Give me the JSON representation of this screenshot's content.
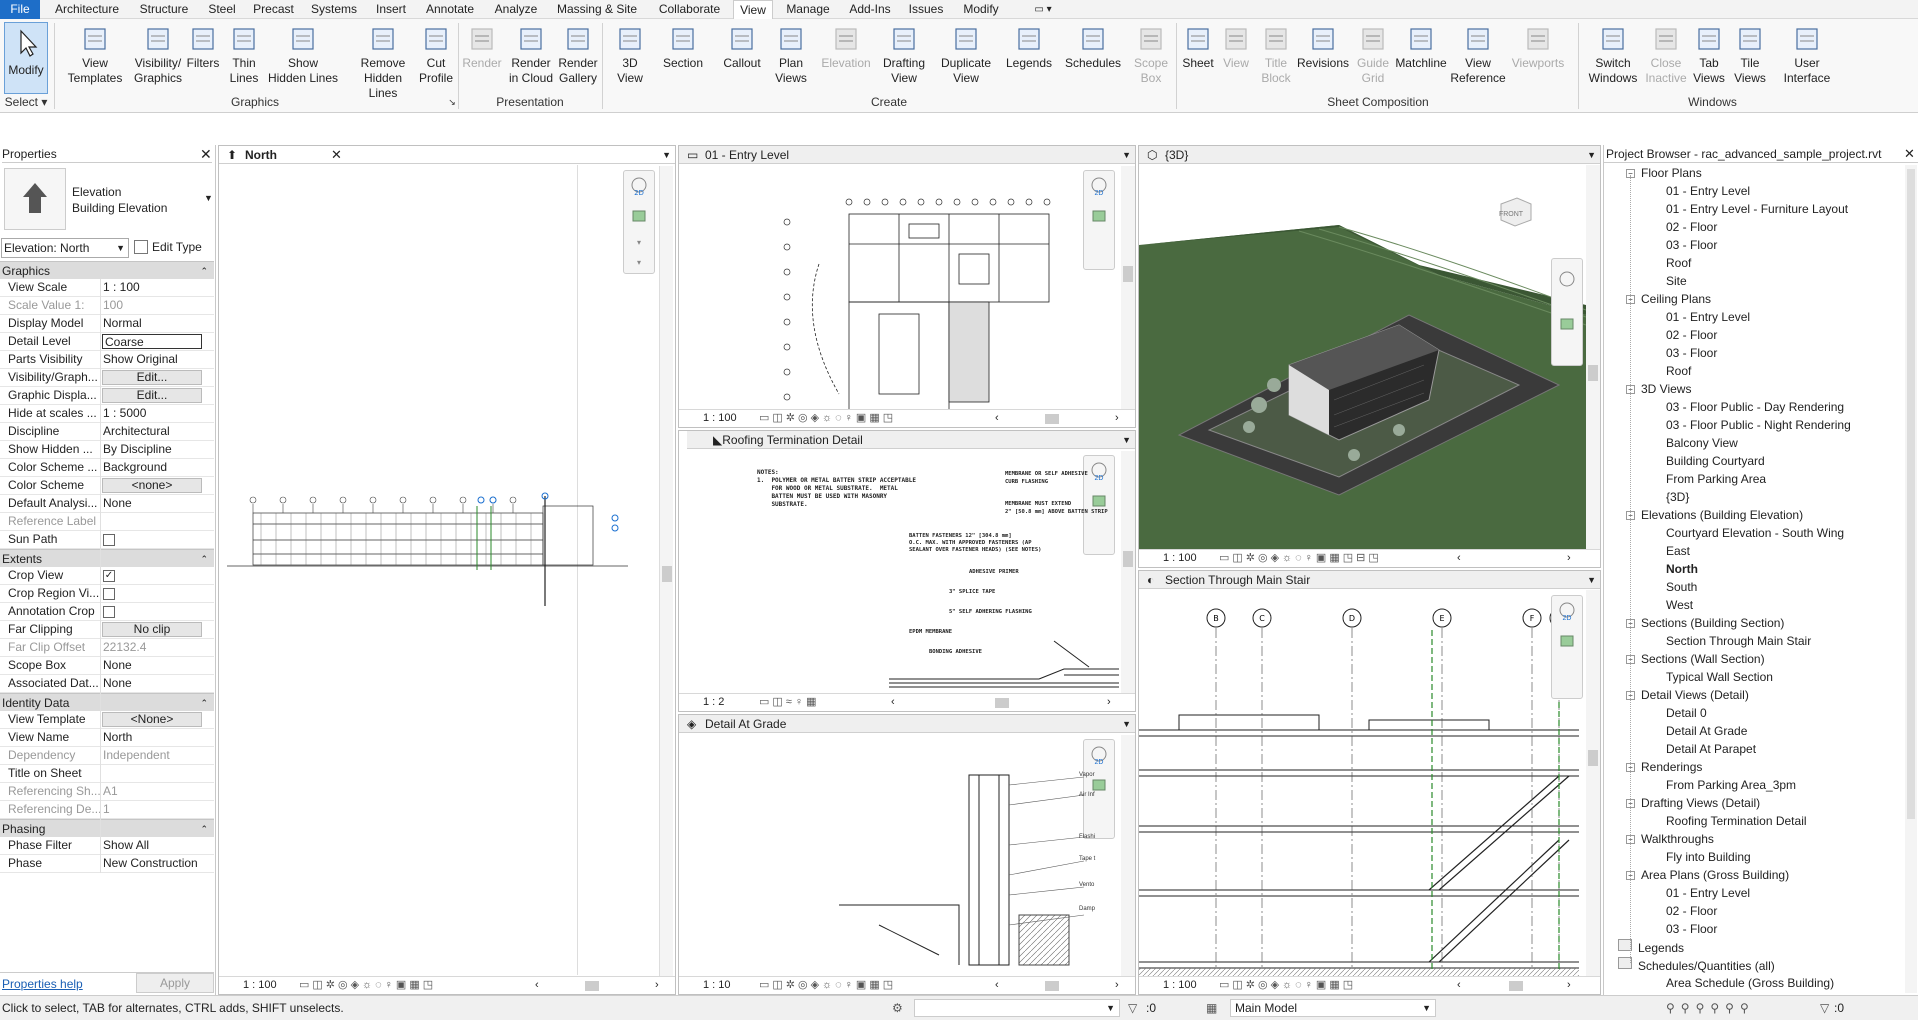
{
  "menu": [
    "File",
    "Architecture",
    "Structure",
    "Steel",
    "Precast",
    "Systems",
    "Insert",
    "Annotate",
    "Analyze",
    "Massing & Site",
    "Collaborate",
    "View",
    "Manage",
    "Add-Ins",
    "Issues",
    "Modify"
  ],
  "ribbon": {
    "modify": "Modify",
    "select": "Select ▾",
    "graphics_buttons": [
      [
        "View",
        "Templates"
      ],
      [
        "Visibility/",
        "Graphics"
      ],
      [
        "Filters",
        ""
      ],
      [
        "Thin",
        "Lines"
      ],
      [
        "Show",
        "Hidden Lines"
      ],
      [
        "Remove",
        "Hidden Lines"
      ],
      [
        "Cut",
        "Profile"
      ]
    ],
    "graphics_label": "Graphics",
    "presentation_buttons": [
      [
        "Render",
        ""
      ],
      [
        "Render",
        "in Cloud"
      ],
      [
        "Render",
        "Gallery"
      ]
    ],
    "presentation_label": "Presentation",
    "create_buttons": [
      [
        "3D",
        "View"
      ],
      [
        "Section",
        ""
      ],
      [
        "Callout",
        ""
      ],
      [
        "Plan",
        "Views"
      ],
      [
        "Elevation",
        ""
      ],
      [
        "Drafting",
        "View"
      ],
      [
        "Duplicate",
        "View"
      ],
      [
        "Legends",
        ""
      ],
      [
        "Schedules",
        ""
      ],
      [
        "Scope",
        "Box"
      ]
    ],
    "create_label": "Create",
    "sheet_buttons": [
      [
        "Sheet",
        ""
      ],
      [
        "View",
        ""
      ],
      [
        "Title",
        "Block"
      ],
      [
        "Revisions",
        ""
      ],
      [
        "Guide",
        "Grid"
      ],
      [
        "Matchline",
        ""
      ],
      [
        "View",
        "Reference"
      ],
      [
        "Viewports",
        ""
      ]
    ],
    "sheet_label": "Sheet Composition",
    "window_buttons": [
      [
        "Switch",
        "Windows"
      ],
      [
        "Close",
        "Inactive"
      ],
      [
        "Tab",
        "Views"
      ],
      [
        "Tile",
        "Views"
      ],
      [
        "User",
        "Interface"
      ]
    ],
    "windows_label": "Windows"
  },
  "properties": {
    "title": "Properties",
    "type_name": "Elevation",
    "type_sub": "Building Elevation",
    "selector": "Elevation: North",
    "edit_type": "Edit Type",
    "sections": [
      {
        "name": "Graphics",
        "rows": [
          [
            "View Scale",
            "1 : 100",
            ""
          ],
          [
            "Scale Value    1:",
            "100",
            "dim"
          ],
          [
            "Display Model",
            "Normal",
            ""
          ],
          [
            "Detail Level",
            "Coarse",
            "box"
          ],
          [
            "Parts Visibility",
            "Show Original",
            ""
          ],
          [
            "Visibility/Graph...",
            "Edit...",
            "btn"
          ],
          [
            "Graphic Displa...",
            "Edit...",
            "btn"
          ],
          [
            "Hide at scales ...",
            "1 : 5000",
            ""
          ],
          [
            "Discipline",
            "Architectural",
            ""
          ],
          [
            "Show Hidden ...",
            "By Discipline",
            ""
          ],
          [
            "Color Scheme ...",
            "Background",
            ""
          ],
          [
            "Color Scheme",
            "<none>",
            "btn"
          ],
          [
            "Default Analysi...",
            "None",
            ""
          ],
          [
            "Reference Label",
            "",
            "dim"
          ],
          [
            "Sun Path",
            "",
            "chk0"
          ]
        ]
      },
      {
        "name": "Extents",
        "rows": [
          [
            "Crop View",
            "",
            "chk1"
          ],
          [
            "Crop Region Vi...",
            "",
            "chk0"
          ],
          [
            "Annotation Crop",
            "",
            "chk0"
          ],
          [
            "Far Clipping",
            "No clip",
            "btn"
          ],
          [
            "Far Clip Offset",
            "22132.4",
            "dim"
          ],
          [
            "Scope Box",
            "None",
            ""
          ],
          [
            "Associated Dat...",
            "None",
            ""
          ]
        ]
      },
      {
        "name": "Identity Data",
        "rows": [
          [
            "View Template",
            "<None>",
            "btn"
          ],
          [
            "View Name",
            "North",
            ""
          ],
          [
            "Dependency",
            "Independent",
            "dim"
          ],
          [
            "Title on Sheet",
            "",
            ""
          ],
          [
            "Referencing Sh...",
            "A1",
            "dim"
          ],
          [
            "Referencing De...",
            "1",
            "dim"
          ]
        ]
      },
      {
        "name": "Phasing",
        "rows": [
          [
            "Phase Filter",
            "Show All",
            ""
          ],
          [
            "Phase",
            "New Construction",
            ""
          ]
        ]
      }
    ],
    "help": "Properties help",
    "apply": "Apply"
  },
  "views": {
    "north": {
      "tab": "North",
      "scale": "1 : 100"
    },
    "entry": {
      "tab": "01 - Entry Level",
      "scale": "1 : 100"
    },
    "roof": {
      "tab": "Roofing Termination Detail",
      "scale": "1 : 2"
    },
    "grade": {
      "tab": "Detail At Grade",
      "scale": "1 : 10"
    },
    "threed": {
      "tab": "{3D}",
      "scale": "1 : 100",
      "cube": "FRONT"
    },
    "section": {
      "tab": "Section Through Main Stair",
      "scale": "1 : 100",
      "grids": [
        "B",
        "C",
        "D",
        "E",
        "F",
        "F.1"
      ]
    }
  },
  "detail_notes": [
    "NOTES:",
    "1.  POLYMER OR METAL BATTEN STRIP ACCEPTABLE",
    "    FOR WOOD OR METAL SUBSTRATE.  METAL",
    "    BATTEN MUST BE USED WITH MASONRY",
    "    SUBSTRATE."
  ],
  "detail_callouts": [
    "MEMBRANE OR SELF ADHESIVE",
    "CURB FLASHING",
    "MEMBRANE MUST EXTEND",
    "2\" [50.8 mm] ABOVE BATTEN STRIP",
    "BATTEN FASTENERS 12\" [304.8 mm]",
    "O.C. MAX. WITH APPROVED FASTENERS (AP",
    "SEALANT OVER FASTENER HEADS) (SEE NOTES)",
    "ADHESIVE PRIMER",
    "3\" SPLICE TAPE",
    "5\" SELF ADHERING FLASHING",
    "EPDM MEMBRANE",
    "BONDING ADHESIVE"
  ],
  "grade_labels": [
    "Vapor",
    "Air Inf",
    "Flashi",
    "Tape t",
    "Vento",
    "Damp"
  ],
  "browser": {
    "title": "Project Browser - rac_advanced_sample_project.rvt",
    "items": [
      [
        "Floor Plans",
        0,
        "-"
      ],
      [
        "01 - Entry Level",
        1,
        ""
      ],
      [
        "01 - Entry Level - Furniture Layout",
        1,
        ""
      ],
      [
        "02 - Floor",
        1,
        ""
      ],
      [
        "03 - Floor",
        1,
        ""
      ],
      [
        "Roof",
        1,
        ""
      ],
      [
        "Site",
        1,
        ""
      ],
      [
        "Ceiling Plans",
        0,
        "-"
      ],
      [
        "01 - Entry Level",
        1,
        ""
      ],
      [
        "02 - Floor",
        1,
        ""
      ],
      [
        "03 - Floor",
        1,
        ""
      ],
      [
        "Roof",
        1,
        ""
      ],
      [
        "3D Views",
        0,
        "-"
      ],
      [
        "03 - Floor Public - Day Rendering",
        1,
        ""
      ],
      [
        "03 - Floor Public - Night Rendering",
        1,
        ""
      ],
      [
        "Balcony View",
        1,
        ""
      ],
      [
        "Building Courtyard",
        1,
        ""
      ],
      [
        "From Parking Area",
        1,
        ""
      ],
      [
        "{3D}",
        1,
        ""
      ],
      [
        "Elevations (Building Elevation)",
        0,
        "-"
      ],
      [
        "Courtyard Elevation - South Wing",
        1,
        ""
      ],
      [
        "East",
        1,
        ""
      ],
      [
        "North",
        1,
        "bold"
      ],
      [
        "South",
        1,
        ""
      ],
      [
        "West",
        1,
        ""
      ],
      [
        "Sections (Building Section)",
        0,
        "-"
      ],
      [
        "Section Through Main Stair",
        1,
        ""
      ],
      [
        "Sections (Wall Section)",
        0,
        "-"
      ],
      [
        "Typical Wall Section",
        1,
        ""
      ],
      [
        "Detail Views (Detail)",
        0,
        "-"
      ],
      [
        "Detail 0",
        1,
        ""
      ],
      [
        "Detail At Grade",
        1,
        ""
      ],
      [
        "Detail At Parapet",
        1,
        ""
      ],
      [
        "Renderings",
        0,
        "-"
      ],
      [
        "From Parking Area_3pm",
        1,
        ""
      ],
      [
        "Drafting Views (Detail)",
        0,
        "-"
      ],
      [
        "Roofing Termination Detail",
        1,
        ""
      ],
      [
        "Walkthroughs",
        0,
        "-"
      ],
      [
        "Fly into Building",
        1,
        ""
      ],
      [
        "Area Plans (Gross Building)",
        0,
        "-"
      ],
      [
        "01 - Entry Level",
        1,
        ""
      ],
      [
        "02 - Floor",
        1,
        ""
      ],
      [
        "03 - Floor",
        1,
        ""
      ],
      [
        "Legends",
        0,
        "icon"
      ],
      [
        "Schedules/Quantities (all)",
        0,
        "icon-"
      ],
      [
        "Area Schedule (Gross Building)",
        1,
        ""
      ]
    ]
  },
  "status": {
    "hint": "Click to select, TAB for alternates, CTRL adds, SHIFT unselects.",
    "zero": ":0",
    "model": "Main Model",
    "filter": ":0"
  }
}
